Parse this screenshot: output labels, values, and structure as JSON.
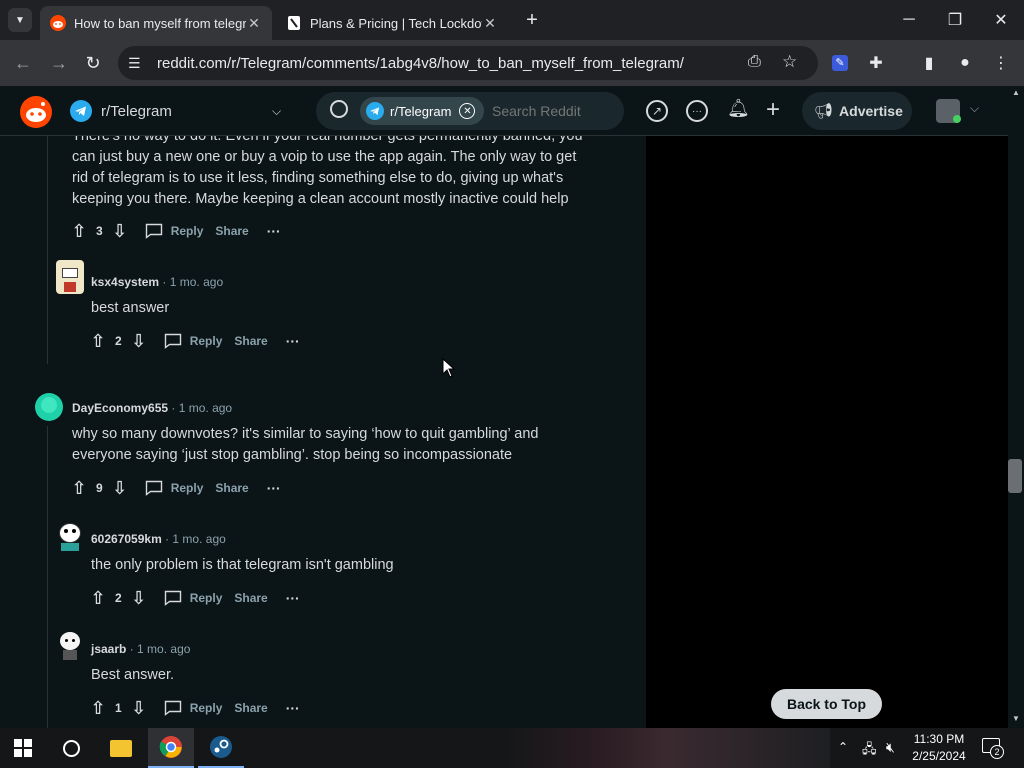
{
  "browser": {
    "tabs": [
      {
        "title": "How to ban myself from telegra",
        "active": true
      },
      {
        "title": "Plans & Pricing | Tech Lockdow",
        "active": false
      }
    ],
    "url": "reddit.com/r/Telegram/comments/1abg4v8/how_to_ban_myself_from_telegram/"
  },
  "reddit": {
    "subreddit": "r/Telegram",
    "search_chip": "r/Telegram",
    "search_placeholder": "Search Reddit",
    "advertise_label": "Advertise"
  },
  "comments": {
    "c0": {
      "lines": [
        "There's no way to do it. Even if your real number gets permanently banned, you",
        "can just buy a new one or buy a voip to use the app again. The only way to get",
        "rid of telegram is to use it less, finding something else to do, giving up what's",
        "keeping you there. Maybe keeping a clean account mostly inactive could help"
      ],
      "votes": "3"
    },
    "c1": {
      "user": "ksx4system",
      "time": "1 mo. ago",
      "text": "best answer",
      "votes": "2"
    },
    "c2": {
      "user": "DayEconomy655",
      "time": "1 mo. ago",
      "lines": [
        "why so many downvotes? it's similar to saying ‘how to quit gambling’ and",
        "everyone saying ‘just stop gambling’. stop being so incompassionate"
      ],
      "votes": "9"
    },
    "c3": {
      "user": "60267059km",
      "time": "1 mo. ago",
      "text": "the only problem is that telegram isn't gambling",
      "votes": "2"
    },
    "c4": {
      "user": "jsaarb",
      "time": "1 mo. ago",
      "text": "Best answer.",
      "votes": "1"
    }
  },
  "actions": {
    "reply": "Reply",
    "share": "Share",
    "more": "···",
    "dot": "·"
  },
  "back_to_top": "Back to Top",
  "taskbar": {
    "time": "11:30 PM",
    "date": "2/25/2024",
    "notifications": "2"
  },
  "colors": {
    "reddit_orange": "#ff4500",
    "bg": "#0b1416",
    "telegram_blue": "#2aabee"
  }
}
